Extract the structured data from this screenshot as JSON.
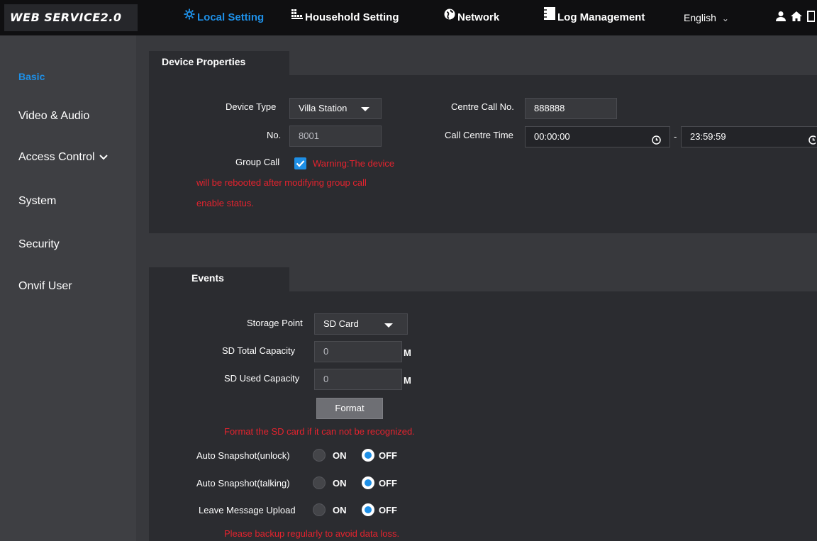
{
  "app": {
    "logo": "WEB SERVICE2.0"
  },
  "nav": {
    "local_setting": "Local Setting",
    "household_setting": "Household Setting",
    "network": "Network",
    "log_management": "Log Management",
    "language": "English",
    "language_caret": "⌄"
  },
  "sidebar": {
    "items": [
      {
        "label": "Basic"
      },
      {
        "label": "Video & Audio"
      },
      {
        "label": "Access Control"
      },
      {
        "label": "System"
      },
      {
        "label": "Security"
      },
      {
        "label": "Onvif User"
      }
    ]
  },
  "device": {
    "title": "Device Properties",
    "device_type_label": "Device Type",
    "device_type_value": "Villa Station",
    "no_label": "No.",
    "no_value": "8001",
    "group_call_label": "Group Call",
    "group_call_checked": true,
    "warning_line1": "Warning:The device",
    "warning_line2": "will be rebooted after modifying group call",
    "warning_line3": "enable status.",
    "centre_call_label": "Centre Call No.",
    "centre_call_value": "888888",
    "call_time_label": "Call Centre Time",
    "call_time_start": "00:00:00",
    "call_time_sep": "-",
    "call_time_end": "23:59:59"
  },
  "events": {
    "title": "Events",
    "storage_label": "Storage Point",
    "storage_value": "SD Card",
    "total_label": "SD Total Capacity",
    "total_value": "0",
    "total_unit": "M",
    "used_label": "SD Used Capacity",
    "used_value": "0",
    "used_unit": "M",
    "format_button": "Format",
    "format_hint": "Format the SD card if it can not be recognized.",
    "snapshot_unlock_label": "Auto Snapshot(unlock)",
    "snapshot_talking_label": "Auto Snapshot(talking)",
    "leave_message_label": "Leave Message Upload",
    "on_label": "ON",
    "off_label": "OFF",
    "selected": "OFF",
    "backup_hint": "Please backup regularly to avoid data loss."
  },
  "colors": {
    "accent": "#1e8fe6",
    "warning": "#e4232e",
    "background": "#38393d",
    "panel": "#2b2c30",
    "topbar": "#0f0f11"
  }
}
